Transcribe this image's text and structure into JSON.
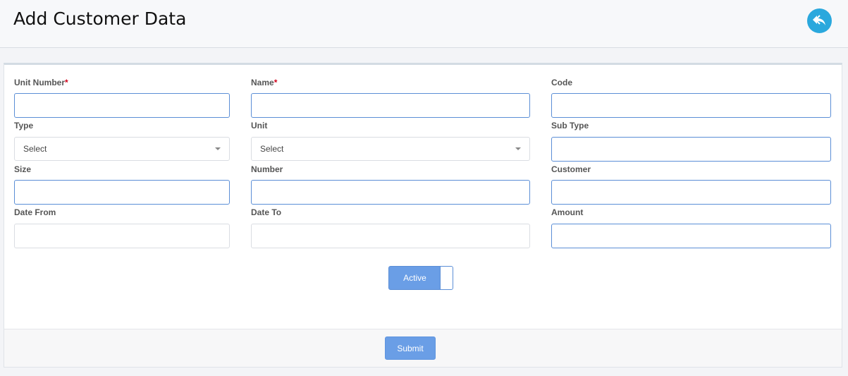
{
  "header": {
    "title": "Add Customer Data",
    "back_icon": "reply-icon"
  },
  "form": {
    "unit_number": {
      "label": "Unit Number",
      "required_mark": "*",
      "value": ""
    },
    "name": {
      "label": "Name",
      "required_mark": "*",
      "value": ""
    },
    "code": {
      "label": "Code",
      "value": ""
    },
    "type": {
      "label": "Type",
      "selected": "Select"
    },
    "unit": {
      "label": "Unit",
      "selected": "Select"
    },
    "sub_type": {
      "label": "Sub Type",
      "value": ""
    },
    "size": {
      "label": "Size",
      "value": ""
    },
    "number": {
      "label": "Number",
      "value": ""
    },
    "customer": {
      "label": "Customer",
      "value": ""
    },
    "date_from": {
      "label": "Date From",
      "value": ""
    },
    "date_to": {
      "label": "Date To",
      "value": ""
    },
    "amount": {
      "label": "Amount",
      "value": ""
    },
    "active_toggle": {
      "label": "Active"
    }
  },
  "footer": {
    "submit_label": "Submit"
  },
  "colors": {
    "accent": "#6a9ee6",
    "back_button": "#2aa8dd",
    "required": "#d0021b"
  }
}
